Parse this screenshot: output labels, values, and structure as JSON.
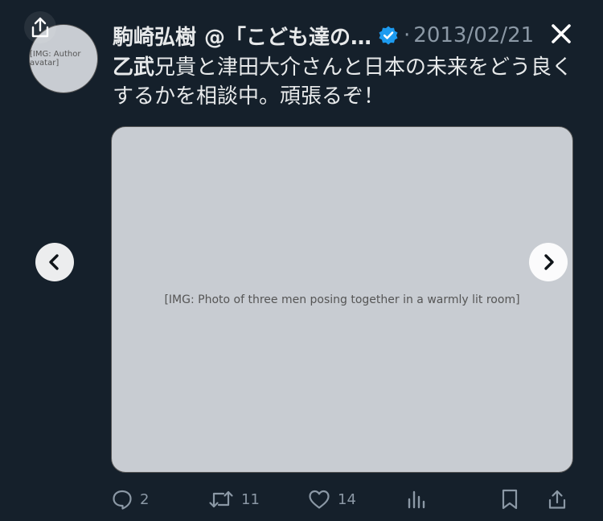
{
  "tweet": {
    "author_name": "駒崎弘樹",
    "handle": "@「こども達の…",
    "timestamp": "2013/02/21",
    "text_emph": "乙武",
    "text_rest": "兄貴と津田大介さんと日本の未来をどう良くするかを相談中。頑張るぞ！"
  },
  "media": {
    "alt": "Photo of three men posing together in a warmly lit room"
  },
  "actions": {
    "reply_count": "2",
    "retweet_count": "11",
    "like_count": "14"
  },
  "colors": {
    "background": "#15202b",
    "text": "#e7e9ea",
    "muted": "#8b98a5",
    "verified": "#1d9bf0"
  }
}
